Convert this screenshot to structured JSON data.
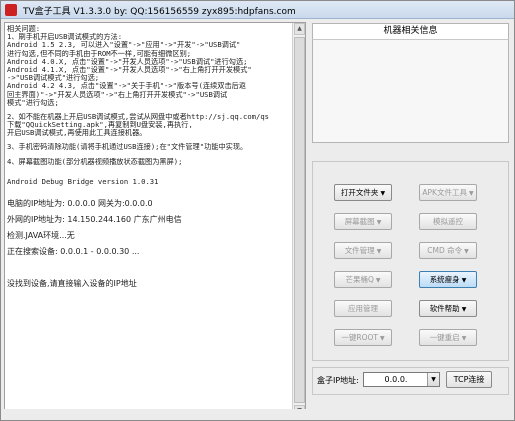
{
  "window": {
    "title": "TV盒子工具 V1.3.3.0 by: QQ:156156559  zyx895:hdpfans.com"
  },
  "log": {
    "lines": [
      "相关问题:",
      "1、刷手机开启USB调试模式的方法:",
      "Android 1.5 2.3, 可以进入\"设置\"->\"应用\"->\"开发\"->\"USB调试\"",
      "进行勾选,但不同的手机由于ROM不一样,可能有细微区别;",
      "Android 4.0.X, 点击\"设置\"->\"开发人员选项\"->\"USB调试\"进行勾选;",
      "Android 4.1.X, 点击\"设置\"->\"开发人员选项\"->\"右上角打开开发模式\"",
      "->\"USB调试模式\"进行勾选;",
      "Android 4.2 4.3, 点击\"设置\"->\"关于手机\"->\"版本号(连续双击后返",
      "回主界面)\"->\"开发人员选项\"->\"右上角打开开发模式\"->\"USB调试",
      "模式\"进行勾选;",
      "",
      "2、如不能在机器上开启USB调试模式,尝试从网盘中或者http://sj.qq.com/qs",
      "下载\"QQuickSetting.apk\",再复制到U盘安装,再执行,",
      "开启USB调试模式,再使用此工具连接机器。",
      "",
      "3、手机密码清除功能(请将手机通过USB连接);在\"文件管理\"功能中实现。",
      "",
      "4、屏幕截图功能(部分机器视频播放状态截图为黑屏);",
      "",
      "",
      "Android Debug Bridge version 1.0.31",
      ""
    ],
    "status": [
      "电脑的IP地址为: 0.0.0.0 网关为:0.0.0.0",
      "外网的IP地址为: 14.150.244.160 广东广州电信",
      "检测.JAVA环境...无",
      "正在搜索设备: 0.0.0.1 - 0.0.0.30 ...",
      "",
      "没找到设备,请直接输入设备的IP地址"
    ]
  },
  "device_panel": {
    "header": "机器相关信息"
  },
  "buttons": {
    "open_folder": "打开文件夹",
    "apk_tools": "APK文件工具",
    "screenshot": "屏幕截图",
    "remote_control": "模拟遥控",
    "file_manager": "文件管理",
    "cmd": "CMD 命令",
    "mango": "芒果桶Q",
    "system_clean": "系统瘦身",
    "app_manager": "应用管理",
    "software_help": "软件帮助",
    "one_key_root": "一键ROOT",
    "one_key_reboot": "一键重启"
  },
  "ip_connect": {
    "label": "盒子IP地址:",
    "value": "0.0.0.",
    "connect_label": "TCP连接"
  },
  "colors": {
    "active_button_border": "#3c7fb1",
    "active_button_fill": "#bcdcf6"
  }
}
